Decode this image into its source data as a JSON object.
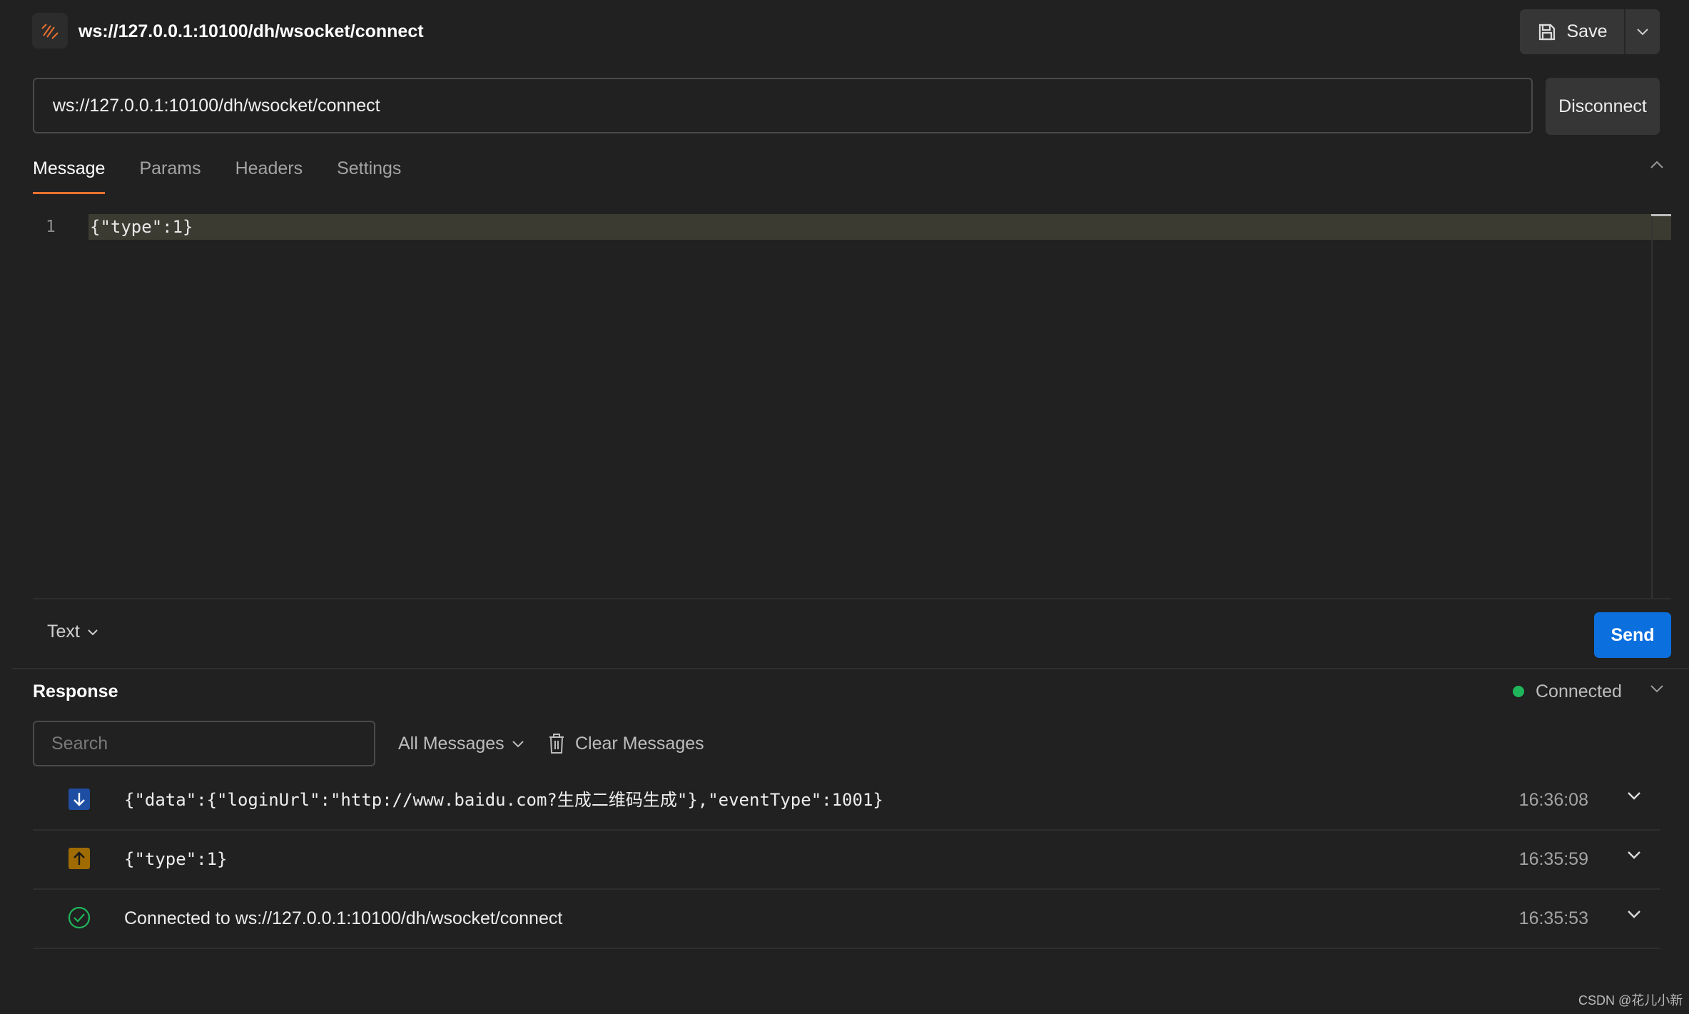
{
  "header": {
    "title": "ws://127.0.0.1:10100/dh/wsocket/connect",
    "save_label": "Save",
    "icon": "websocket-icon"
  },
  "request": {
    "url": "ws://127.0.0.1:10100/dh/wsocket/connect",
    "disconnect_label": "Disconnect",
    "tabs": [
      {
        "label": "Message",
        "active": true
      },
      {
        "label": "Params",
        "active": false
      },
      {
        "label": "Headers",
        "active": false
      },
      {
        "label": "Settings",
        "active": false
      }
    ],
    "editor": {
      "line_number": "1",
      "line_text": "{\"type\":1}"
    },
    "format_label": "Text",
    "send_label": "Send"
  },
  "response": {
    "title": "Response",
    "status": "Connected",
    "status_color": "#1fb65b",
    "search_placeholder": "Search",
    "filter_label": "All Messages",
    "clear_label": "Clear Messages",
    "messages": [
      {
        "direction": "incoming",
        "icon": "arrow-down-icon",
        "text": "{\"data\":{\"loginUrl\":\"http://www.baidu.com?生成二维码生成\"},\"eventType\":1001}",
        "time": "16:36:08"
      },
      {
        "direction": "outgoing",
        "icon": "arrow-up-icon",
        "text": "{\"type\":1}",
        "time": "16:35:59"
      },
      {
        "direction": "connected",
        "icon": "check-circle-icon",
        "text": "Connected to ws://127.0.0.1:10100/dh/wsocket/connect",
        "time": "16:35:53"
      }
    ]
  },
  "watermark": "CSDN @花儿小新",
  "colors": {
    "accent_tab": "#e8702f",
    "send_button": "#0b6fde",
    "incoming_badge": "#1d4ea3",
    "outgoing_badge": "#a06b00"
  }
}
